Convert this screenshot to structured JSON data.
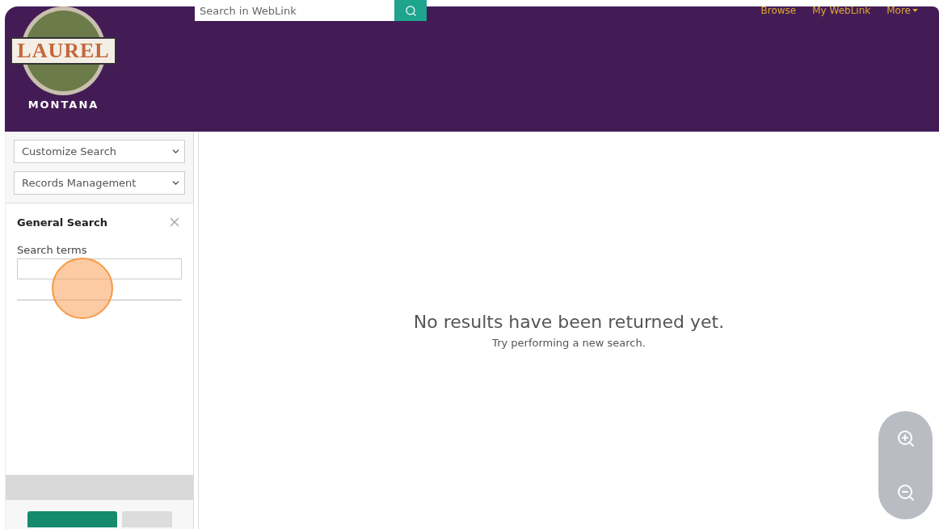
{
  "header": {
    "logo": {
      "name": "LAUREL",
      "state": "MONTANA"
    },
    "search": {
      "placeholder": "Search in WebLink"
    },
    "nav": [
      {
        "label": "Browse",
        "kind": "link"
      },
      {
        "label": "My WebLink",
        "kind": "link"
      },
      {
        "label": "More",
        "kind": "dropdown"
      }
    ]
  },
  "sidebar": {
    "selects": [
      {
        "value": "Customize Search"
      },
      {
        "value": "Records Management"
      }
    ],
    "panel": {
      "title": "General Search",
      "field_label": "Search terms"
    },
    "buttons": [
      {
        "kind": "primary"
      },
      {
        "kind": "secondary"
      }
    ]
  },
  "results": {
    "message": "No results have been returned yet.",
    "hint": "Try performing a new search."
  },
  "click_indicator": true
}
